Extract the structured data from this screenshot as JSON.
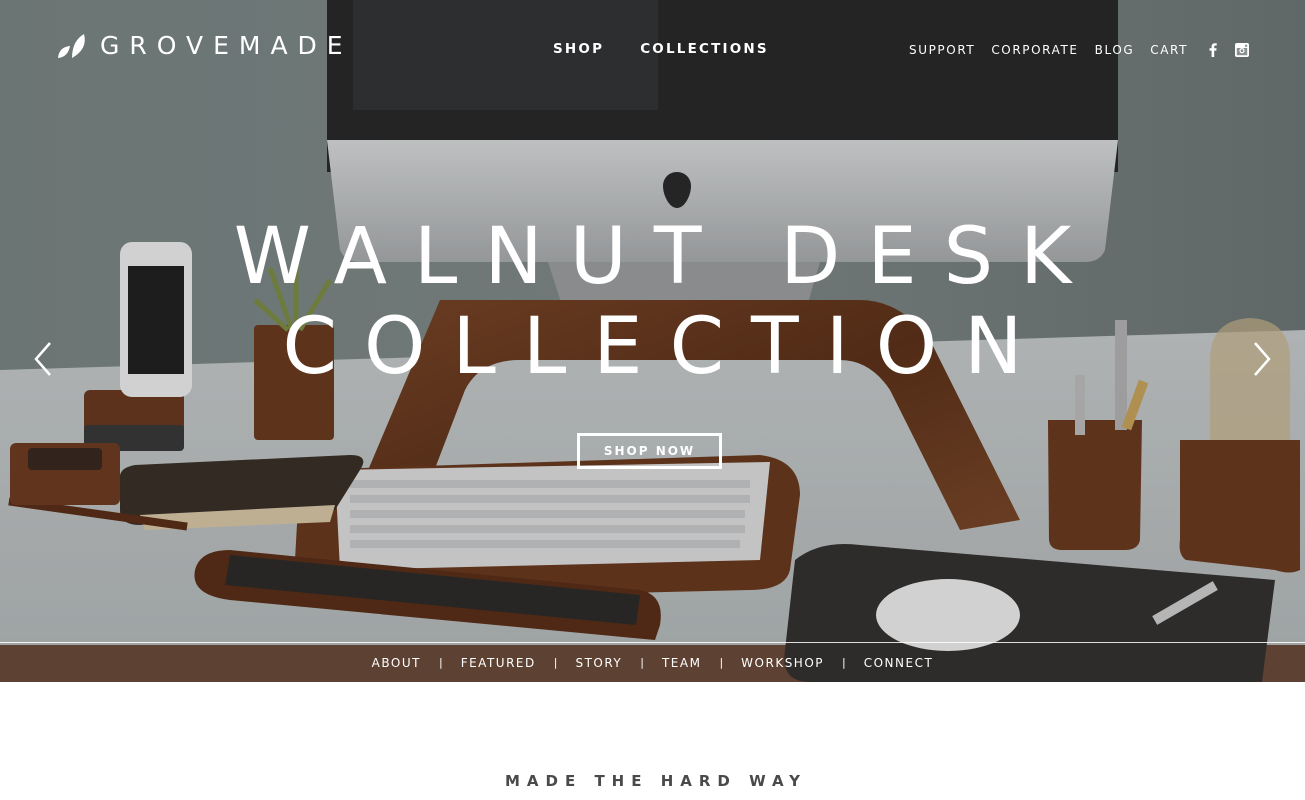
{
  "brand": {
    "name": "GROVEMADE",
    "logo_icon": "leaf-logo-icon"
  },
  "main_nav": [
    {
      "label": "SHOP"
    },
    {
      "label": "COLLECTIONS"
    }
  ],
  "util_nav": [
    {
      "label": "SUPPORT"
    },
    {
      "label": "CORPORATE"
    },
    {
      "label": "BLOG"
    },
    {
      "label": "CART"
    }
  ],
  "social": [
    {
      "icon": "facebook-icon"
    },
    {
      "icon": "instagram-icon"
    }
  ],
  "hero": {
    "title_line1": "WALNUT DESK",
    "title_line2": "COLLECTION",
    "cta_label": "SHOP NOW",
    "prev_icon": "chevron-left-icon",
    "next_icon": "chevron-right-icon"
  },
  "sub_nav": [
    {
      "label": "ABOUT"
    },
    {
      "label": "FEATURED"
    },
    {
      "label": "STORY"
    },
    {
      "label": "TEAM"
    },
    {
      "label": "WORKSHOP"
    },
    {
      "label": "CONNECT"
    }
  ],
  "sub_nav_separator": "|",
  "section": {
    "tagline": "MADE THE HARD WAY"
  },
  "colors": {
    "overlay_text": "#ffffff",
    "tagline": "#4a4a4a",
    "walnut": "#6e3f23",
    "wall": "#7b8584"
  }
}
